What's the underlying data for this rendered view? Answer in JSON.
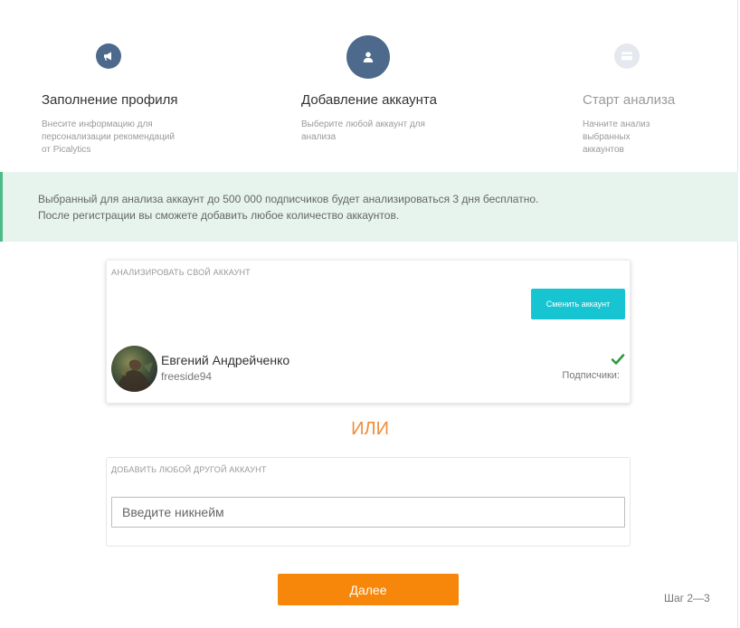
{
  "steps": [
    {
      "title": "Заполнение профиля",
      "description": "Внесите информацию для персонализации рекомендаций от Picalytics",
      "icon": "megaphone-icon",
      "state": "done",
      "color": "#4d6a8c"
    },
    {
      "title": "Добавление аккаунта",
      "description": "Выберите любой аккаунт для анализа",
      "icon": "user-icon",
      "state": "active",
      "color": "#4d6a8c"
    },
    {
      "title": "Старт анализа",
      "description": "Начните анализ выбранных аккаунтов",
      "icon": "card-icon",
      "state": "pending",
      "color": "#e6e8ef"
    }
  ],
  "banner": {
    "line1": "Выбранный для анализа аккаунт до 500 000 подписчиков будет анализироваться 3 дня бесплатно.",
    "line2": "После регистрации вы сможете добавить любое количество аккаунтов.",
    "accent": "#4cbb86",
    "background": "#e6f4ed"
  },
  "own_account": {
    "label": "АНАЛИЗИРОВАТЬ СВОЙ АККАУНТ",
    "switch_button": "Сменить аккаунт",
    "name": "Евгений Андрейченко",
    "handle": "freeside94",
    "followers_label": "Подписчики:",
    "selected": true
  },
  "or_label": "ИЛИ",
  "other_account": {
    "label": "ДОБАВИТЬ ЛЮБОЙ ДРУГОЙ АККАУНТ",
    "input_value": "",
    "input_placeholder": "Введите никнейм"
  },
  "next_button": "Далее",
  "step_counter": "Шаг 2—3",
  "colors": {
    "primary": "#f7870a",
    "switch_button": "#17c5d2",
    "or_text": "#f08d3c",
    "check": "#2e9a3c"
  }
}
